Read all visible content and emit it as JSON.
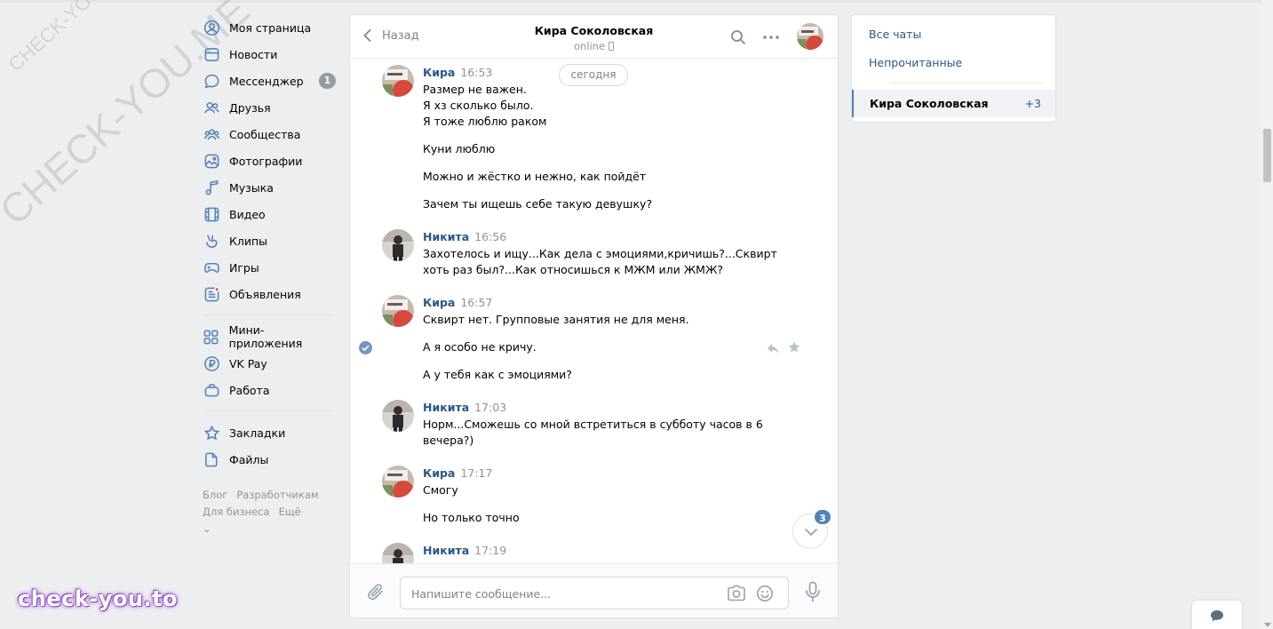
{
  "watermark": "CHECK-YOU.ME",
  "brand": "check-you.to",
  "left_nav": {
    "items": [
      {
        "label": "Моя страница",
        "icon": "user-icon"
      },
      {
        "label": "Новости",
        "icon": "news-icon"
      },
      {
        "label": "Мессенджер",
        "icon": "messenger-icon",
        "badge": "1"
      },
      {
        "label": "Друзья",
        "icon": "friends-icon"
      },
      {
        "label": "Сообщества",
        "icon": "communities-icon"
      },
      {
        "label": "Фотографии",
        "icon": "photos-icon"
      },
      {
        "label": "Музыка",
        "icon": "music-icon"
      },
      {
        "label": "Видео",
        "icon": "video-icon"
      },
      {
        "label": "Клипы",
        "icon": "clips-icon"
      },
      {
        "label": "Игры",
        "icon": "games-icon"
      },
      {
        "label": "Объявления",
        "icon": "ads-icon"
      }
    ],
    "items2": [
      {
        "label": "Мини-приложения",
        "icon": "apps-icon"
      },
      {
        "label": "VK Pay",
        "icon": "vkpay-icon"
      },
      {
        "label": "Работа",
        "icon": "work-icon"
      }
    ],
    "items3": [
      {
        "label": "Закладки",
        "icon": "bookmarks-icon"
      },
      {
        "label": "Файлы",
        "icon": "files-icon"
      }
    ],
    "footer": [
      "Блог",
      "Разработчикам",
      "Для бизнеса",
      "Ещё"
    ]
  },
  "chat": {
    "back_label": "Назад",
    "peer_name": "Кира Соколовская",
    "peer_status": "online",
    "date_pill": "сегодня",
    "messages": [
      {
        "author": "Кира",
        "time": "16:53",
        "lines": [
          "Размер не важен.",
          "Я хз сколько было.",
          "Я тоже люблю раком",
          "Куни люблю",
          "Можно и жёстко и нежно, как пойдёт",
          "Зачем ты ищешь себе такую девушку?"
        ]
      },
      {
        "author": "Никита",
        "time": "16:56",
        "lines": [
          "Захотелось и ищу...Как дела с эмоциями,кричишь?...Сквирт",
          "хоть раз был?...Как относишься к МЖМ или ЖМЖ?"
        ]
      },
      {
        "author": "Кира",
        "time": "16:57",
        "lines": [
          "Сквирт нет. Групповые занятия не для меня.",
          "А я особо не кричу.",
          "А у тебя как с эмоциями?"
        ]
      },
      {
        "author": "Никита",
        "time": "17:03",
        "lines": [
          "Норм...Сможешь со мной встретиться в субботу часов в 6",
          "вечера?)"
        ]
      },
      {
        "author": "Кира",
        "time": "17:17",
        "lines": [
          "Смогу",
          "Но только точно"
        ]
      },
      {
        "author": "Никита",
        "time": "17:19",
        "lines": []
      }
    ],
    "unread_badge": "3",
    "composer_placeholder": "Напишите сообщение..."
  },
  "right_panel": {
    "all_chats": "Все чаты",
    "unread": "Непрочитанные",
    "active_chat": "Кира Соколовская",
    "active_count": "+3"
  },
  "colors": {
    "accent": "#5181b8",
    "link": "#2a5885",
    "background": "#edeef0"
  }
}
